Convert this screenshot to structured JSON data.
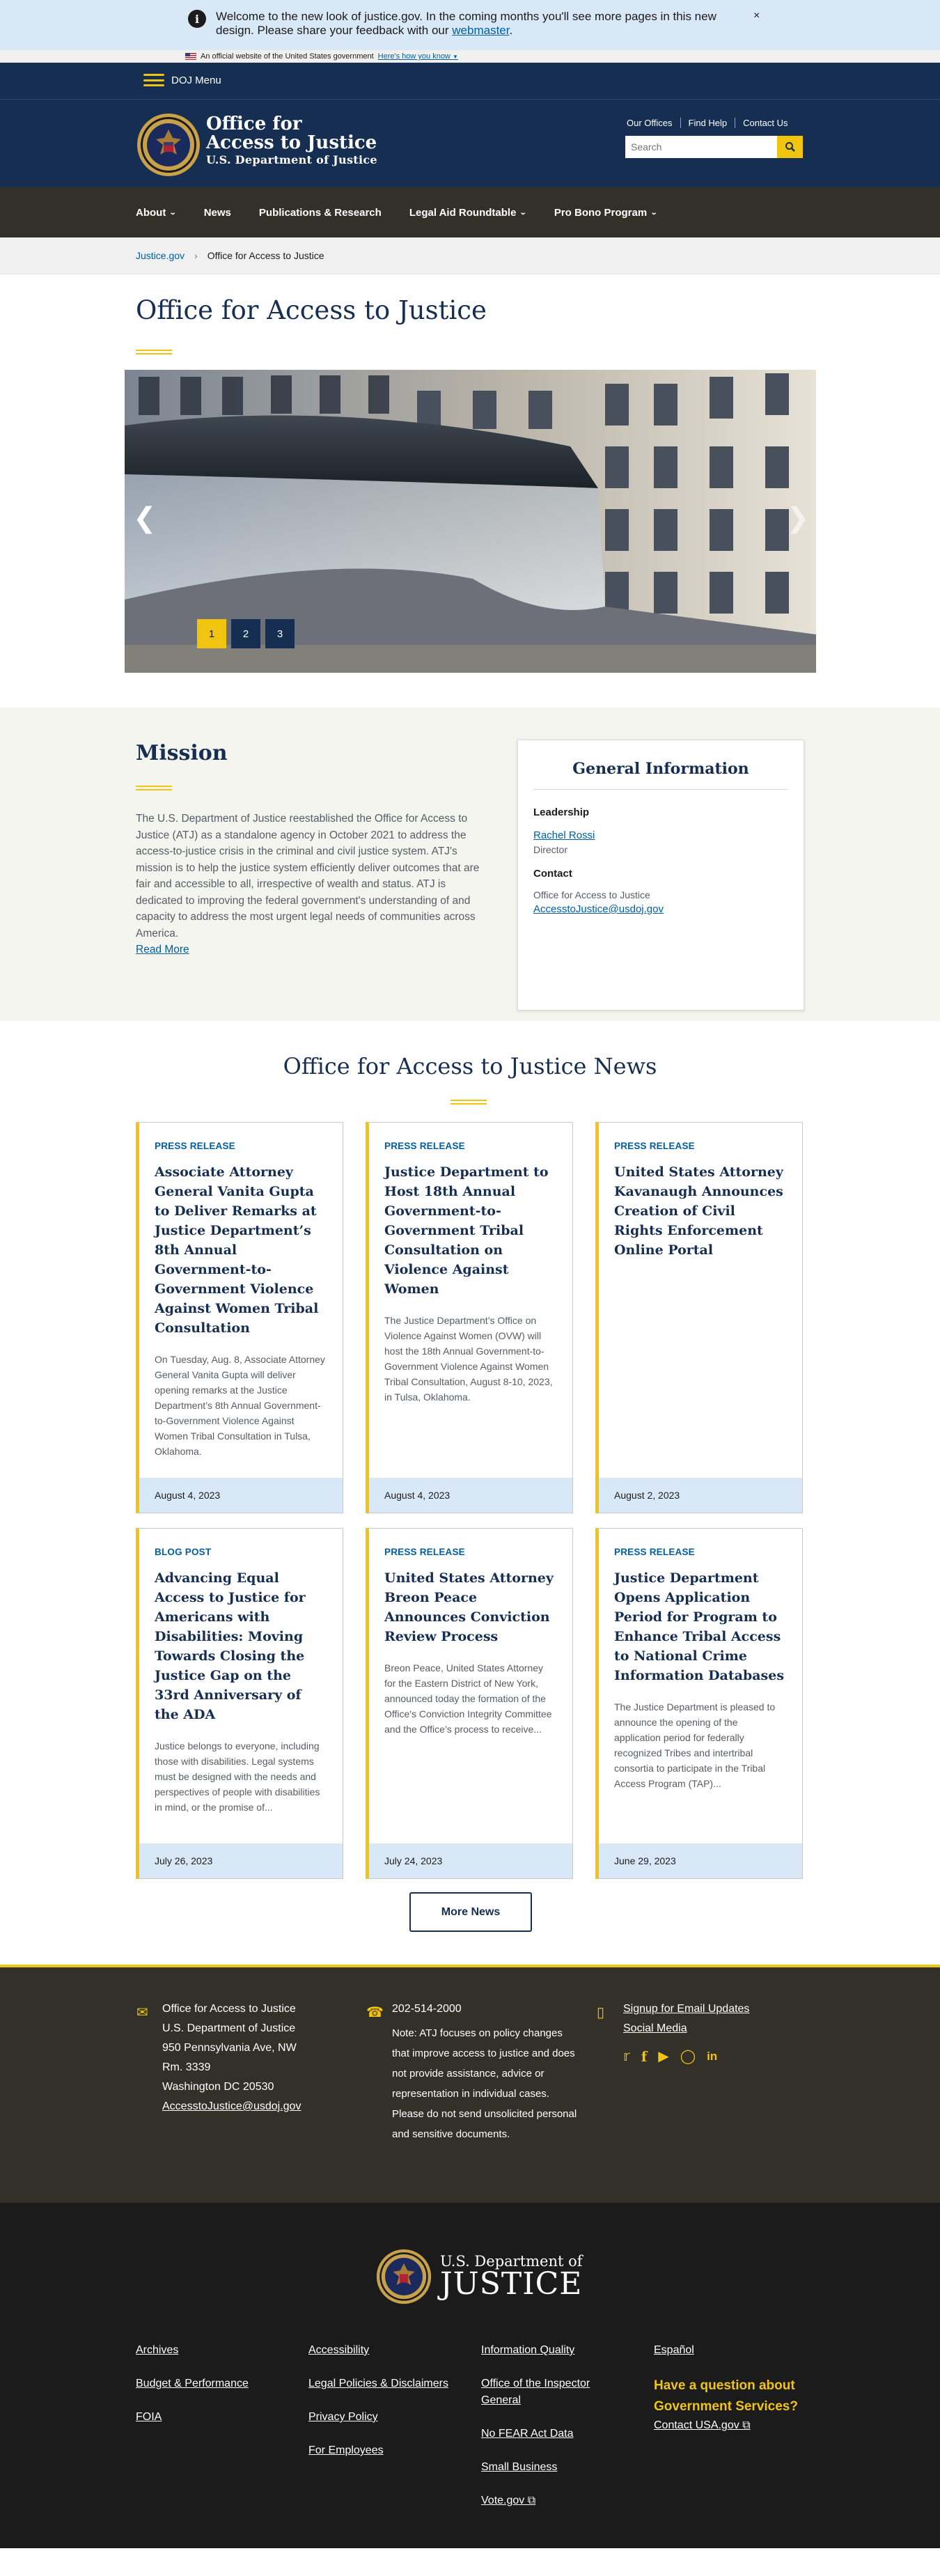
{
  "alert": {
    "text": "Welcome to the new look of justice.gov. In the coming months you'll see more pages in this new design. Please share your feedback with our ",
    "link": "webmaster",
    "text_end": ".",
    "close": "×"
  },
  "gov_banner": {
    "text": "An official website of the United States government",
    "link": "Here's how you know"
  },
  "doj_menu": {
    "label": "DOJ Menu"
  },
  "header": {
    "title_line1": "Office for",
    "title_line2": "Access to Justice",
    "title_line3": "U.S. Department of Justice",
    "util_links": [
      "Our Offices",
      "Find Help",
      "Contact Us"
    ],
    "search_placeholder": "Search"
  },
  "main_nav": [
    {
      "label": "About",
      "has_dropdown": true
    },
    {
      "label": "News",
      "has_dropdown": false
    },
    {
      "label": "Publications & Research",
      "has_dropdown": false
    },
    {
      "label": "Legal Aid Roundtable",
      "has_dropdown": true
    },
    {
      "label": "Pro Bono Program",
      "has_dropdown": true
    }
  ],
  "breadcrumb": {
    "home": "Justice.gov",
    "current": "Office for Access to Justice"
  },
  "page_title": "Office for Access to Justice",
  "carousel": {
    "slides": [
      "1",
      "2",
      "3"
    ],
    "active": "1"
  },
  "mission": {
    "heading": "Mission",
    "body": "The U.S. Department of Justice reestablished the Office for Access to Justice (ATJ) as a standalone agency in October 2021 to address the access-to-justice crisis in the criminal and civil justice system. ATJ's mission is to help the justice system efficiently deliver outcomes that are fair and accessible to all, irrespective of wealth and status. ATJ is dedicated to improving the federal government's understanding of and capacity to address the most urgent legal needs of communities across America.",
    "read_more": "Read More"
  },
  "general_info": {
    "heading": "General Information",
    "leadership_label": "Leadership",
    "leader_name": "Rachel Rossi",
    "leader_role": "Director",
    "contact_label": "Contact",
    "office": "Office for Access to Justice",
    "email": "AccesstoJustice@usdoj.gov"
  },
  "news": {
    "heading": "Office for Access to Justice News",
    "cards": [
      {
        "type": "PRESS RELEASE",
        "title": "Associate Attorney General Vanita Gupta to Deliver Remarks at Justice Department’s 8th Annual Government-to-Government Violence Against Women Tribal Consultation",
        "desc": "On Tuesday, Aug. 8, Associate Attorney General Vanita Gupta will deliver opening remarks at the Justice Department’s 8th Annual Government-to-Government Violence Against Women Tribal Consultation in Tulsa, Oklahoma.",
        "date": "August 4, 2023"
      },
      {
        "type": "PRESS RELEASE",
        "title": "Justice Department to Host 18th Annual Government-to-Government Tribal Consultation on Violence Against Women",
        "desc": "The Justice Department’s Office on Violence Against Women (OVW) will host the 18th Annual Government-to-Government Violence Against Women Tribal Consultation, August 8-10, 2023, in Tulsa, Oklahoma.",
        "date": "August 4, 2023"
      },
      {
        "type": "PRESS RELEASE",
        "title": "United States Attorney Kavanaugh Announces Creation of Civil Rights Enforcement Online Portal",
        "desc": "",
        "date": "August 2, 2023"
      },
      {
        "type": "BLOG POST",
        "title": "Advancing Equal Access to Justice for Americans with Disabilities: Moving Towards Closing the Justice Gap on the 33rd Anniversary of the ADA",
        "desc": "Justice belongs to everyone, including those with disabilities. Legal systems must be designed with the needs and perspectives of people with disabilities in mind, or the promise of...",
        "date": "July 26, 2023"
      },
      {
        "type": "PRESS RELEASE",
        "title": "United States Attorney Breon Peace Announces Conviction Review Process",
        "desc": "Breon Peace, United States Attorney for the Eastern District of New York, announced today the formation of the Office's Conviction Integrity Committee and the Office’s process to receive...",
        "date": "July 24, 2023"
      },
      {
        "type": "PRESS RELEASE",
        "title": "Justice Department Opens Application Period for Program to Enhance Tribal Access to National Crime Information Databases",
        "desc": "The Justice Department is pleased to announce the opening of the application period for federally recognized Tribes and intertribal consortia to participate in the Tribal Access Program (TAP)...",
        "date": "June 29, 2023"
      }
    ],
    "more_button": "More News"
  },
  "contact_footer": {
    "address": [
      "Office for Access to Justice",
      "U.S. Department of Justice",
      "950 Pennsylvania Ave, NW",
      "Rm. 3339",
      "Washington DC 20530"
    ],
    "email": "AccesstoJustice@usdoj.gov",
    "phone": "202-514-2000",
    "note": "Note: ATJ focuses on policy changes that improve access to justice and does not provide assistance, advice or representation in individual cases. Please do not send unsolicited personal and sensitive documents.",
    "signup": "Signup for Email Updates",
    "social_media": "Social Media",
    "social_icons": [
      "twitter-icon",
      "facebook-icon",
      "youtube-icon",
      "instagram-icon",
      "linkedin-icon"
    ]
  },
  "bottom_footer": {
    "logo_line1": "U.S. Department of",
    "logo_line2": "JUSTICE",
    "col1": [
      "Archives",
      "Budget & Performance",
      "FOIA"
    ],
    "col2": [
      "Accessibility",
      "Legal Policies & Disclaimers",
      "Privacy Policy",
      "For Employees"
    ],
    "col3": [
      "Information Quality",
      "Office of the Inspector General",
      "No FEAR Act Data",
      "Small Business",
      "Vote.gov"
    ],
    "col4_lang": "Español",
    "question": "Have a question about Government Services?",
    "contact_usa": "Contact USA.gov"
  },
  "colors": {
    "navy": "#162e51",
    "gold": "#f1c40f",
    "link": "#005ea2",
    "dark": "#333029"
  }
}
